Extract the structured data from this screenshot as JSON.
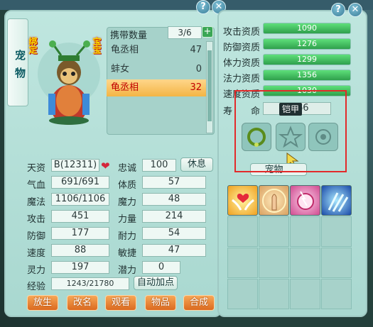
{
  "window": {
    "help_label": "?",
    "close_label": "✕"
  },
  "sidebar_tab": "宠物",
  "tags": {
    "bound": "绑定",
    "treasure": "宝宝"
  },
  "pet_list": {
    "header": "携带数量",
    "count": "3/6",
    "add_label": "+",
    "items": [
      {
        "name": "龟丞相",
        "level": "47",
        "selected": false
      },
      {
        "name": "蚌女",
        "level": "0",
        "selected": false
      },
      {
        "name": "龟丞相",
        "level": "32",
        "selected": true
      }
    ]
  },
  "stats": {
    "tianzi_label": "天资",
    "tianzi": "B(12311)",
    "loyalty_label": "忠诚",
    "loyalty": "100",
    "rest_label": "休息",
    "hp_label": "气血",
    "hp": "691/691",
    "con_label": "体质",
    "con": "57",
    "mp_label": "魔法",
    "mp": "1106/1106",
    "magic_label": "魔力",
    "magic": "48",
    "atk_label": "攻击",
    "atk": "451",
    "str_label": "力量",
    "str": "214",
    "def_label": "防御",
    "def": "177",
    "end_label": "耐力",
    "end": "54",
    "spd_label": "速度",
    "spd": "88",
    "agi_label": "敏捷",
    "agi": "47",
    "spi_label": "灵力",
    "spi": "197",
    "pot_label": "潜力",
    "pot": "0",
    "exp_label": "经验",
    "exp": "1243/21780",
    "auto_label": "自动加点"
  },
  "actions": [
    "放生",
    "改名",
    "观看",
    "物品",
    "合成"
  ],
  "aptitudes": [
    {
      "label": "攻击资质",
      "value": "1090",
      "fill": 1.0
    },
    {
      "label": "防御资质",
      "value": "1276",
      "fill": 1.0
    },
    {
      "label": "体力资质",
      "value": "1299",
      "fill": 1.0
    },
    {
      "label": "法力资质",
      "value": "1356",
      "fill": 1.0
    },
    {
      "label": "速度资质",
      "value": "1030",
      "fill": 1.0
    }
  ],
  "lifespan": {
    "label": "寿　　命",
    "value": "2766"
  },
  "equipment": {
    "tooltip": "铠甲",
    "section_label": "宠物…"
  },
  "colors": {
    "accent_green": "#2fa04c",
    "highlight_red": "#e22a2a",
    "selected_text": "#c10000"
  }
}
